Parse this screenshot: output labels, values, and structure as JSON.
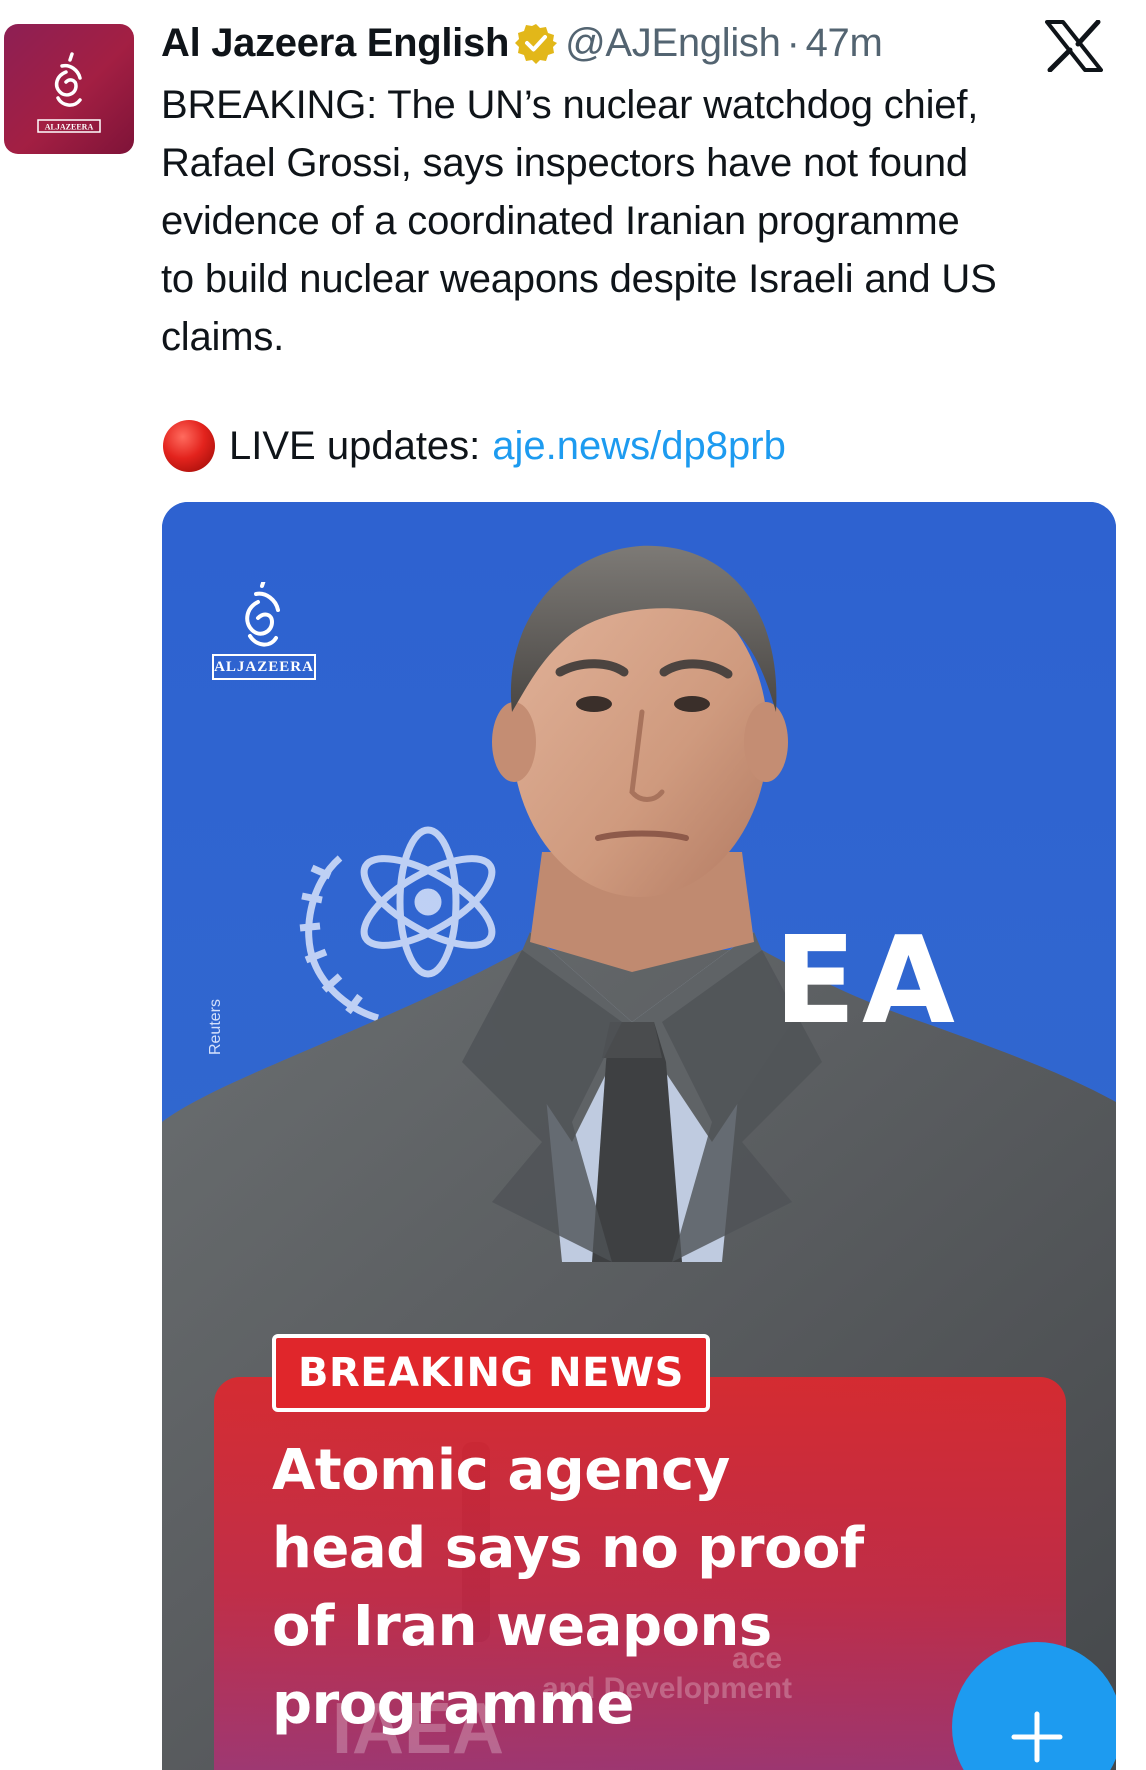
{
  "tweet": {
    "author": {
      "display_name": "Al Jazeera English",
      "handle": "@AJEnglish",
      "separator": "·",
      "time": "47m",
      "verified": true,
      "verified_color": "#e2b719",
      "avatar_label": "ALJAZEERA"
    },
    "platform_icon": "x-logo-icon",
    "text_lines": [
      "BREAKING: The UN’s nuclear watchdog chief,",
      "Rafael Grossi, says inspectors have not found",
      "evidence of a coordinated Iranian programme",
      "to build nuclear weapons despite Israeli and US",
      "claims."
    ],
    "live": {
      "icon": "red-circle-icon",
      "label": "LIVE updates:",
      "link_text": "aje.news/dp8prb"
    }
  },
  "media": {
    "logo_text": "ALJAZEERA",
    "photo_credit": "Reuters",
    "backdrop_text": "EA",
    "badge": "BREAKING NEWS",
    "headline_lines": [
      "Atomic agency",
      "head says no proof",
      "of Iran weapons",
      "programme"
    ],
    "background_text": {
      "iaea": "IAEA",
      "tail_1": "ace",
      "tail_2": "and Development"
    },
    "fab_icon": "plus-icon"
  },
  "colors": {
    "text_primary": "#0f1419",
    "text_secondary": "#536471",
    "link": "#1d9bf0",
    "backdrop_blue": "#2f63cf",
    "breaking_red": "#e0262b",
    "avatar_red": "#a31f43"
  }
}
